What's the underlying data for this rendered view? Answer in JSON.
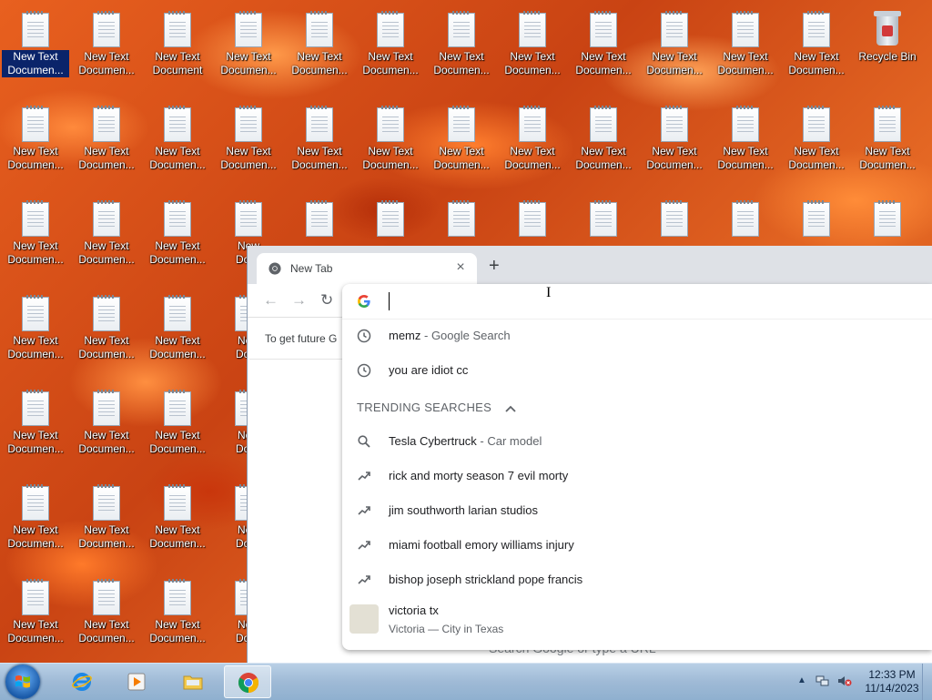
{
  "desktop": {
    "icon_label_short": "New Text Documen...",
    "icon_label_full": "New Text Document",
    "recycle_bin_label": "Recycle Bin",
    "icons": [
      {
        "col": 0,
        "row": 0,
        "label": "New Text\nDocumen...",
        "selected": true
      },
      {
        "col": 1,
        "row": 0,
        "label": "New Text\nDocumen..."
      },
      {
        "col": 2,
        "row": 0,
        "label": "New Text\nDocument"
      },
      {
        "col": 3,
        "row": 0,
        "label": "New Text\nDocumen..."
      },
      {
        "col": 4,
        "row": 0,
        "label": "New Text\nDocumen..."
      },
      {
        "col": 5,
        "row": 0,
        "label": "New Text\nDocumen..."
      },
      {
        "col": 6,
        "row": 0,
        "label": "New Text\nDocumen..."
      },
      {
        "col": 7,
        "row": 0,
        "label": "New Text\nDocumen..."
      },
      {
        "col": 8,
        "row": 0,
        "label": "New Text\nDocumen..."
      },
      {
        "col": 9,
        "row": 0,
        "label": "New Text\nDocumen..."
      },
      {
        "col": 10,
        "row": 0,
        "label": "New Text\nDocumen..."
      },
      {
        "col": 11,
        "row": 0,
        "label": "New Text\nDocumen..."
      },
      {
        "col": 0,
        "row": 1,
        "label": "New Text\nDocumen..."
      },
      {
        "col": 1,
        "row": 1,
        "label": "New Text\nDocumen..."
      },
      {
        "col": 2,
        "row": 1,
        "label": "New Text\nDocumen..."
      },
      {
        "col": 3,
        "row": 1,
        "label": "New Text\nDocumen..."
      },
      {
        "col": 4,
        "row": 1,
        "label": "New Text\nDocumen..."
      },
      {
        "col": 5,
        "row": 1,
        "label": "New Text\nDocumen..."
      },
      {
        "col": 6,
        "row": 1,
        "label": "New Text\nDocumen..."
      },
      {
        "col": 7,
        "row": 1,
        "label": "New Text\nDocumen..."
      },
      {
        "col": 8,
        "row": 1,
        "label": "New Text\nDocumen..."
      },
      {
        "col": 9,
        "row": 1,
        "label": "New Text\nDocumen..."
      },
      {
        "col": 10,
        "row": 1,
        "label": "New Text\nDocumen..."
      },
      {
        "col": 11,
        "row": 1,
        "label": "New Text\nDocumen..."
      },
      {
        "col": 12,
        "row": 1,
        "label": "New Text\nDocumen..."
      },
      {
        "col": 0,
        "row": 2,
        "label": "New Text\nDocumen..."
      },
      {
        "col": 1,
        "row": 2,
        "label": "New Text\nDocumen..."
      },
      {
        "col": 2,
        "row": 2,
        "label": "New Text\nDocumen..."
      },
      {
        "col": 3,
        "row": 2,
        "label": "New\nDocu"
      },
      {
        "col": 4,
        "row": 2,
        "label": ""
      },
      {
        "col": 5,
        "row": 2,
        "label": ""
      },
      {
        "col": 6,
        "row": 2,
        "label": ""
      },
      {
        "col": 7,
        "row": 2,
        "label": ""
      },
      {
        "col": 8,
        "row": 2,
        "label": ""
      },
      {
        "col": 9,
        "row": 2,
        "label": ""
      },
      {
        "col": 10,
        "row": 2,
        "label": ""
      },
      {
        "col": 11,
        "row": 2,
        "label": ""
      },
      {
        "col": 12,
        "row": 2,
        "label": ""
      },
      {
        "col": 0,
        "row": 3,
        "label": "New Text\nDocumen..."
      },
      {
        "col": 1,
        "row": 3,
        "label": "New Text\nDocumen..."
      },
      {
        "col": 2,
        "row": 3,
        "label": "New Text\nDocumen..."
      },
      {
        "col": 3,
        "row": 3,
        "label": "New\nDocu"
      },
      {
        "col": 0,
        "row": 4,
        "label": "New Text\nDocumen..."
      },
      {
        "col": 1,
        "row": 4,
        "label": "New Text\nDocumen..."
      },
      {
        "col": 2,
        "row": 4,
        "label": "New Text\nDocumen..."
      },
      {
        "col": 3,
        "row": 4,
        "label": "New\nDocu"
      },
      {
        "col": 0,
        "row": 5,
        "label": "New Text\nDocumen..."
      },
      {
        "col": 1,
        "row": 5,
        "label": "New Text\nDocumen..."
      },
      {
        "col": 2,
        "row": 5,
        "label": "New Text\nDocumen..."
      },
      {
        "col": 3,
        "row": 5,
        "label": "New\nDocu"
      },
      {
        "col": 0,
        "row": 6,
        "label": "New Text\nDocumen..."
      },
      {
        "col": 1,
        "row": 6,
        "label": "New Text\nDocumen..."
      },
      {
        "col": 2,
        "row": 6,
        "label": "New Text\nDocumen..."
      },
      {
        "col": 3,
        "row": 6,
        "label": "New\nDocu"
      }
    ]
  },
  "chrome": {
    "tab_title": "New Tab",
    "tab_close": "×",
    "new_tab_symbol": "+",
    "back_symbol": "←",
    "forward_symbol": "→",
    "reload_symbol": "↻",
    "infobar_text": "To get future G",
    "ntp_search_placeholder": "Search Google or type a URL"
  },
  "omnibox": {
    "input_value": "",
    "history": [
      {
        "text": "memz",
        "sub": " - Google Search"
      },
      {
        "text": "you are idiot cc",
        "sub": ""
      }
    ],
    "trending_header": "TRENDING SEARCHES",
    "trending": [
      {
        "text": "Tesla Cybertruck",
        "sub": " - Car model",
        "icon": "search-icon"
      },
      {
        "text": "rick and morty season 7 evil morty",
        "sub": "",
        "icon": "trending-icon"
      },
      {
        "text": "jim southworth larian studios",
        "sub": "",
        "icon": "trending-icon"
      },
      {
        "text": "miami football emory williams injury",
        "sub": "",
        "icon": "trending-icon"
      },
      {
        "text": "bishop joseph strickland pope francis",
        "sub": "",
        "icon": "trending-icon"
      }
    ],
    "entity": {
      "title": "victoria tx",
      "subtitle": "Victoria — City in Texas"
    }
  },
  "taskbar": {
    "clock_time": "12:33 PM",
    "clock_date": "11/14/2023",
    "tray_arrow": "▲"
  },
  "colors": {
    "wallpaper": "#d9521a",
    "taskbar": "#9fbad6",
    "chrome_tabstrip": "#dee1e6",
    "selection": "#0a246a"
  }
}
